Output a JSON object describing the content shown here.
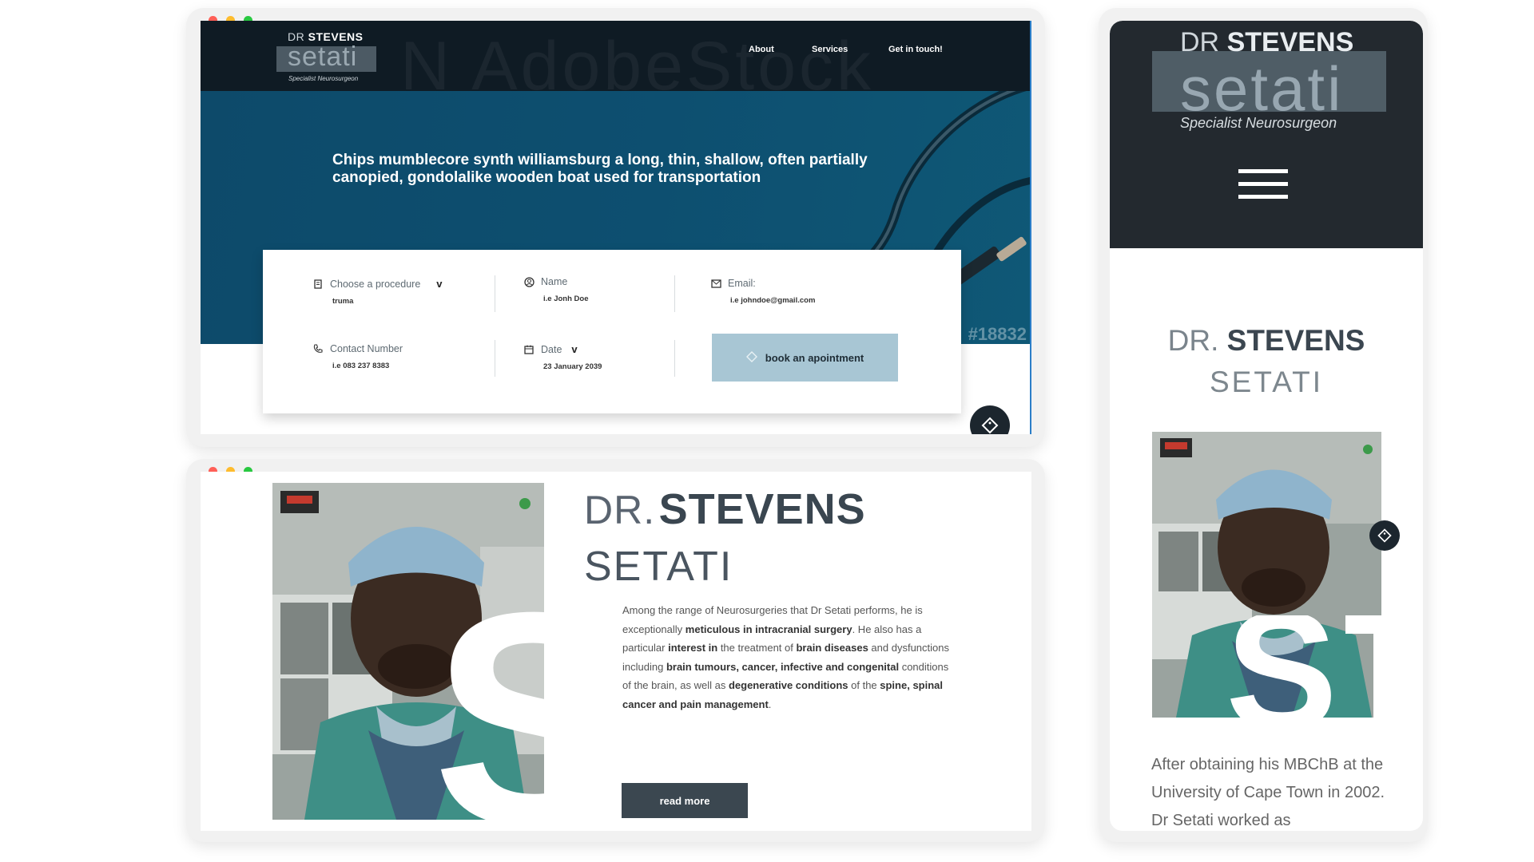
{
  "desktop_hero": {
    "logo": {
      "dr": "DR",
      "stevens": "STEVENS",
      "setati": "setati",
      "specialty": "Specialist Neurosurgeon"
    },
    "nav": [
      {
        "label": "About"
      },
      {
        "label": "Services"
      },
      {
        "label": "Get in touch!"
      }
    ],
    "headline": "Chips mumblecore synth williamsburg a long, thin, shallow, often partially canopied, gondolalike wooden boat used for transportation",
    "image_watermark": "#18832",
    "booking": {
      "procedure_label": "Choose a procedure",
      "procedure_value": "truma",
      "name_label": "Name",
      "name_value": "i.e Jonh Doe",
      "email_label": "Email:",
      "email_value": "i.e johndoe@gmail.com",
      "contact_label": "Contact Number",
      "contact_value": "i.e 083 237 8383",
      "date_label": "Date",
      "date_value": "23 January 2039",
      "book_button": "book an apointment"
    }
  },
  "desktop_about": {
    "title_dr": "DR.",
    "title_stevens": "STEVENS",
    "title_setati": "SETATI",
    "paragraph": [
      {
        "text": "Among the range of Neurosurgeries that Dr Setati performs, he is exceptionally ",
        "bold": false
      },
      {
        "text": "meticulous in intracranial surgery",
        "bold": true
      },
      {
        "text": ". He also has a particular ",
        "bold": false
      },
      {
        "text": "interest in",
        "bold": true
      },
      {
        "text": " the treatment of ",
        "bold": false
      },
      {
        "text": "brain diseases",
        "bold": true
      },
      {
        "text": " and dysfunctions including ",
        "bold": false
      },
      {
        "text": "brain tumours, cancer, infective and congenital",
        "bold": true
      },
      {
        "text": " conditions of the brain, as well as ",
        "bold": false
      },
      {
        "text": "degenerative conditions",
        "bold": true
      },
      {
        "text": " of the ",
        "bold": false
      },
      {
        "text": "spine, spinal cancer and pain management",
        "bold": true
      },
      {
        "text": ".",
        "bold": false
      }
    ],
    "read_more": "read more",
    "photo_letter": "S"
  },
  "mobile": {
    "logo": {
      "dr": "DR",
      "stevens": "STEVENS",
      "setati": "setati",
      "specialty": "Specialist Neurosurgeon"
    },
    "name_dr": "DR.",
    "name_stevens": "STEVENS",
    "name_setati": "SETATI",
    "paragraph": "After obtaining his MBChB at the University of Cape Town in 2002. Dr Setati worked as"
  },
  "colors": {
    "dot_red": "#ff5f57",
    "dot_yellow": "#febc2e",
    "dot_green": "#28c840",
    "hero_blue": "#0d4f70",
    "dark_header": "#23292f",
    "accent_button": "#a8c6d4",
    "dark_button": "#3b4750"
  }
}
